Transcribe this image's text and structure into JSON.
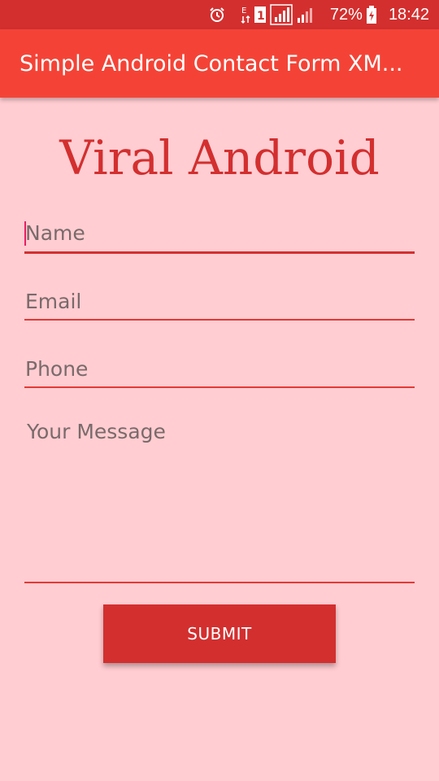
{
  "status_bar": {
    "battery": "72%",
    "time": "18:42",
    "icons": [
      "alarm-icon",
      "data-signal-icon",
      "sim-1-icon",
      "cell-signal-1-icon",
      "cell-signal-2-icon",
      "battery-charging-icon"
    ]
  },
  "app_bar": {
    "title": "Simple Android Contact Form XM..."
  },
  "heading": "Viral Android",
  "form": {
    "name_placeholder": "Name",
    "email_placeholder": "Email",
    "phone_placeholder": "Phone",
    "message_placeholder": "Your Message",
    "submit_label": "SUBMIT"
  },
  "colors": {
    "status_bar": "#d32f2f",
    "app_bar": "#f44336",
    "background": "#ffcdd2",
    "accent": "#d32f2f"
  }
}
